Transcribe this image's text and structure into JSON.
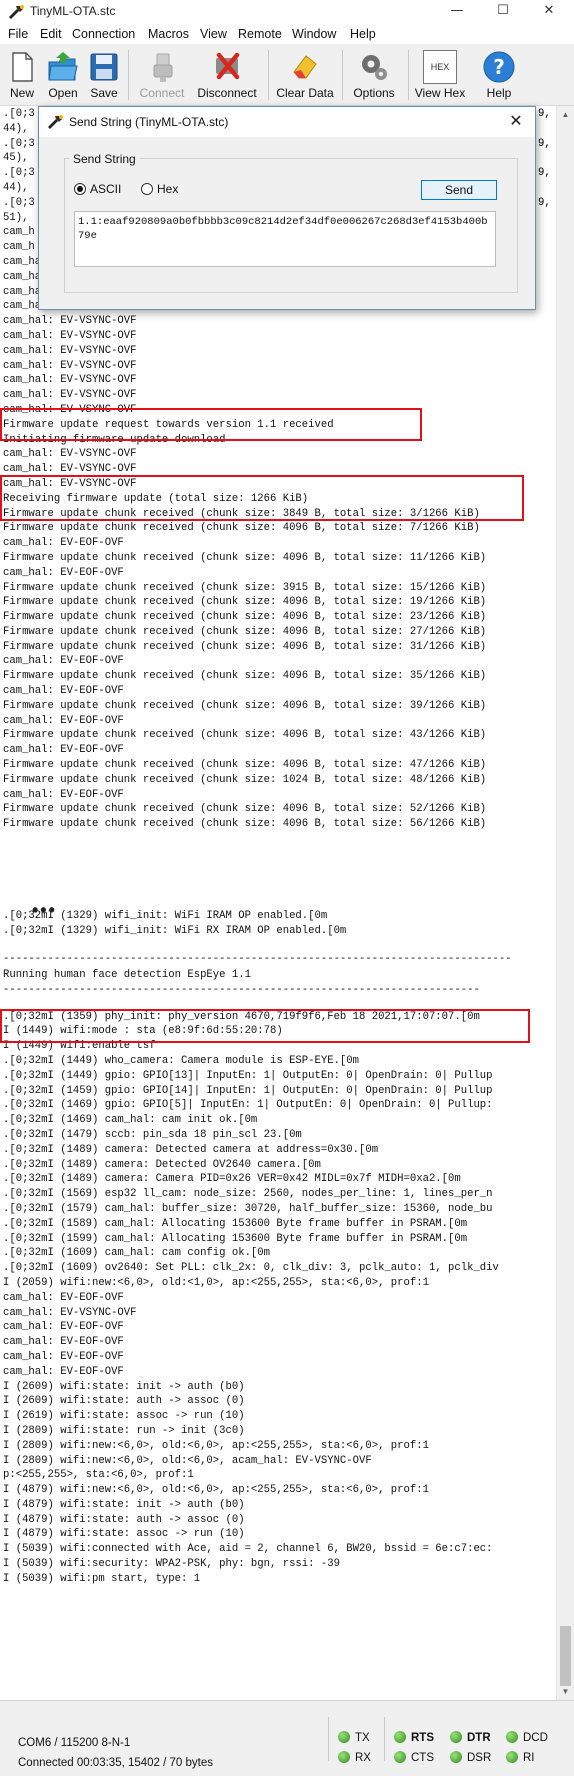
{
  "window": {
    "title": "TinyML-OTA.stc",
    "minimize": "—",
    "maximize": "☐",
    "close": "✕"
  },
  "menu": [
    "File",
    "Edit",
    "Connection",
    "Macros",
    "View",
    "Remote",
    "Window",
    "Help"
  ],
  "toolbar": {
    "new": "New",
    "open": "Open",
    "save": "Save",
    "connect": "Connect",
    "disconnect": "Disconnect",
    "clear_data": "Clear Data",
    "options": "Options",
    "view_hex": "View Hex",
    "help": "Help",
    "hex_icon_text": "HEX"
  },
  "dialog": {
    "title": "Send String (TinyML-OTA.stc)",
    "group_label": "Send String",
    "ascii_label": "ASCII",
    "hex_label": "Hex",
    "selected_mode": "ASCII",
    "send_label": "Send",
    "text_value": "1.1:eaaf920809a0b0fbbbb3c09c8214d2ef34df0e006267c268d3ef4153b400b79e"
  },
  "terminal": {
    "ellipsis": "•••",
    "lines_top": [
      ".[0;3",
      "44),",
      ".[0;3",
      "45),",
      ".[0;3",
      "44),",
      ".[0;3",
      "51),",
      "cam_h",
      "cam_h",
      "cam_hal: EV-VSYNC-OVF",
      "cam_hal: EV-VSYNC-OVF",
      "cam_hal: EV-VSYNC-OVF",
      "cam_hal: EV-VSYNC-OVF",
      "cam_hal: EV-VSYNC-OVF",
      "cam_hal: EV-VSYNC-OVF",
      "cam_hal: EV-VSYNC-OVF",
      "cam_hal: EV-VSYNC-OVF",
      "cam_hal: EV-VSYNC-OVF",
      "cam_hal: EV-VSYNC-OVF",
      "cam_hal: EV-VSYNC-OVF",
      "Firmware update request towards version 1.1 received",
      "Initiating firmware update download",
      "cam_hal: EV-VSYNC-OVF",
      "cam_hal: EV-VSYNC-OVF",
      "cam_hal: EV-VSYNC-OVF",
      "Receiving firmware update (total size: 1266 KiB)",
      "Firmware update chunk received (chunk size: 3849 B, total size: 3/1266 KiB)",
      "Firmware update chunk received (chunk size: 4096 B, total size: 7/1266 KiB)",
      "cam_hal: EV-EOF-OVF",
      "Firmware update chunk received (chunk size: 4096 B, total size: 11/1266 KiB)",
      "cam_hal: EV-EOF-OVF",
      "Firmware update chunk received (chunk size: 3915 B, total size: 15/1266 KiB)",
      "Firmware update chunk received (chunk size: 4096 B, total size: 19/1266 KiB)",
      "Firmware update chunk received (chunk size: 4096 B, total size: 23/1266 KiB)",
      "Firmware update chunk received (chunk size: 4096 B, total size: 27/1266 KiB)",
      "Firmware update chunk received (chunk size: 4096 B, total size: 31/1266 KiB)",
      "cam_hal: EV-EOF-OVF",
      "Firmware update chunk received (chunk size: 4096 B, total size: 35/1266 KiB)",
      "cam_hal: EV-EOF-OVF",
      "Firmware update chunk received (chunk size: 4096 B, total size: 39/1266 KiB)",
      "cam_hal: EV-EOF-OVF",
      "Firmware update chunk received (chunk size: 4096 B, total size: 43/1266 KiB)",
      "cam_hal: EV-EOF-OVF",
      "Firmware update chunk received (chunk size: 4096 B, total size: 47/1266 KiB)",
      "Firmware update chunk received (chunk size: 1024 B, total size: 48/1266 KiB)",
      "cam_hal: EV-EOF-OVF",
      "Firmware update chunk received (chunk size: 4096 B, total size: 52/1266 KiB)",
      "Firmware update chunk received (chunk size: 4096 B, total size: 56/1266 KiB)"
    ],
    "right_fragments": [
      "9,",
      "9,",
      "9,",
      "9,"
    ],
    "lines_mid": [
      ".[0;32mI (1329) wifi_init: WiFi IRAM OP enabled.[0m",
      ".[0;32mI (1329) wifi_init: WiFi RX IRAM OP enabled.[0m"
    ],
    "separator_top": "--------------------------------------------------------------------------------",
    "banner": "Running human face detection EspEye 1.1",
    "separator_bottom": "---------------------------------------------------------------------------",
    "lines_bottom": [
      ".[0;32mI (1359) phy_init: phy_version 4670,719f9f6,Feb 18 2021,17:07:07.[0m",
      "I (1449) wifi:mode : sta (e8:9f:6d:55:20:78)",
      "I (1449) wifi:enable tsf",
      ".[0;32mI (1449) who_camera: Camera module is ESP-EYE.[0m",
      ".[0;32mI (1449) gpio: GPIO[13]| InputEn: 1| OutputEn: 0| OpenDrain: 0| Pullup",
      ".[0;32mI (1459) gpio: GPIO[14]| InputEn: 1| OutputEn: 0| OpenDrain: 0| Pullup",
      ".[0;32mI (1469) gpio: GPIO[5]| InputEn: 1| OutputEn: 0| OpenDrain: 0| Pullup:",
      ".[0;32mI (1469) cam_hal: cam init ok.[0m",
      ".[0;32mI (1479) sccb: pin_sda 18 pin_scl 23.[0m",
      ".[0;32mI (1489) camera: Detected camera at address=0x30.[0m",
      ".[0;32mI (1489) camera: Detected OV2640 camera.[0m",
      ".[0;32mI (1489) camera: Camera PID=0x26 VER=0x42 MIDL=0x7f MIDH=0xa2.[0m",
      ".[0;32mI (1569) esp32 ll_cam: node_size: 2560, nodes_per_line: 1, lines_per_n",
      ".[0;32mI (1579) cam_hal: buffer_size: 30720, half_buffer_size: 15360, node_bu",
      ".[0;32mI (1589) cam_hal: Allocating 153600 Byte frame buffer in PSRAM.[0m",
      ".[0;32mI (1599) cam_hal: Allocating 153600 Byte frame buffer in PSRAM.[0m",
      ".[0;32mI (1609) cam_hal: cam config ok.[0m",
      ".[0;32mI (1609) ov2640: Set PLL: clk_2x: 0, clk_div: 3, pclk_auto: 1, pclk_div",
      "I (2059) wifi:new:<6,0>, old:<1,0>, ap:<255,255>, sta:<6,0>, prof:1",
      "cam_hal: EV-EOF-OVF",
      "cam_hal: EV-VSYNC-OVF",
      "cam_hal: EV-EOF-OVF",
      "cam_hal: EV-EOF-OVF",
      "cam_hal: EV-EOF-OVF",
      "cam_hal: EV-EOF-OVF",
      "I (2609) wifi:state: init -> auth (b0)",
      "I (2609) wifi:state: auth -> assoc (0)",
      "I (2619) wifi:state: assoc -> run (10)",
      "I (2809) wifi:state: run -> init (3c0)",
      "I (2809) wifi:new:<6,0>, old:<6,0>, ap:<255,255>, sta:<6,0>, prof:1",
      "I (2809) wifi:new:<6,0>, old:<6,0>, acam_hal: EV-VSYNC-OVF",
      "p:<255,255>, sta:<6,0>, prof:1",
      "I (4879) wifi:new:<6,0>, old:<6,0>, ap:<255,255>, sta:<6,0>, prof:1",
      "I (4879) wifi:state: init -> auth (b0)",
      "I (4879) wifi:state: auth -> assoc (0)",
      "I (4879) wifi:state: assoc -> run (10)",
      "I (5039) wifi:connected with Ace, aid = 2, channel 6, BW20, bssid = 6e:c7:ec:",
      "I (5039) wifi:security: WPA2-PSK, phy: bgn, rssi: -39",
      "I (5039) wifi:pm start, type: 1"
    ]
  },
  "status": {
    "port": "COM6 / 115200 8-N-1",
    "connection": "Connected 00:03:35, 15402 / 70 bytes",
    "signals": {
      "tx": "TX",
      "rx": "RX",
      "rts": "RTS",
      "cts": "CTS",
      "dtr": "DTR",
      "dsr": "DSR",
      "dcd": "DCD",
      "ri": "RI"
    }
  },
  "colors": {
    "highlight": "#e2101b",
    "led_on": "#2d8a1c",
    "toolbar_bg": "#f0f0f0"
  }
}
